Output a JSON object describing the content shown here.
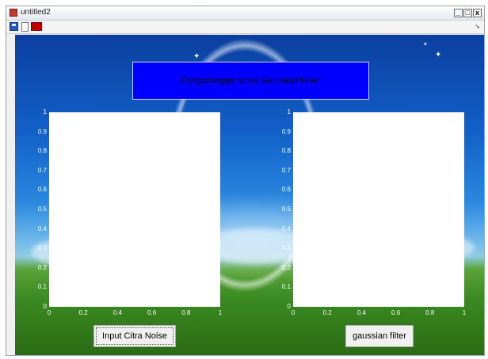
{
  "window": {
    "title": "untitled2"
  },
  "toolbar": {
    "items": [
      "save-icon",
      "new-icon",
      "red-icon"
    ]
  },
  "banner": {
    "text": "Pengurangan Noise Gaussian Filter"
  },
  "axes_ticks": {
    "y": [
      "1",
      "0.9",
      "0.8",
      "0.7",
      "0.6",
      "0.5",
      "0.4",
      "0.3",
      "0.2",
      "0.1",
      "0"
    ],
    "x": [
      "0",
      "0.2",
      "0.4",
      "0.6",
      "0.8",
      "1"
    ]
  },
  "buttons": {
    "input_label": "Input Citra Noise",
    "filter_label": "gaussian filter"
  },
  "chart_data": [
    {
      "type": "scatter",
      "title": "",
      "xlabel": "",
      "ylabel": "",
      "xlim": [
        0,
        1
      ],
      "ylim": [
        0,
        1
      ],
      "series": []
    },
    {
      "type": "scatter",
      "title": "",
      "xlabel": "",
      "ylabel": "",
      "xlim": [
        0,
        1
      ],
      "ylim": [
        0,
        1
      ],
      "series": []
    }
  ]
}
